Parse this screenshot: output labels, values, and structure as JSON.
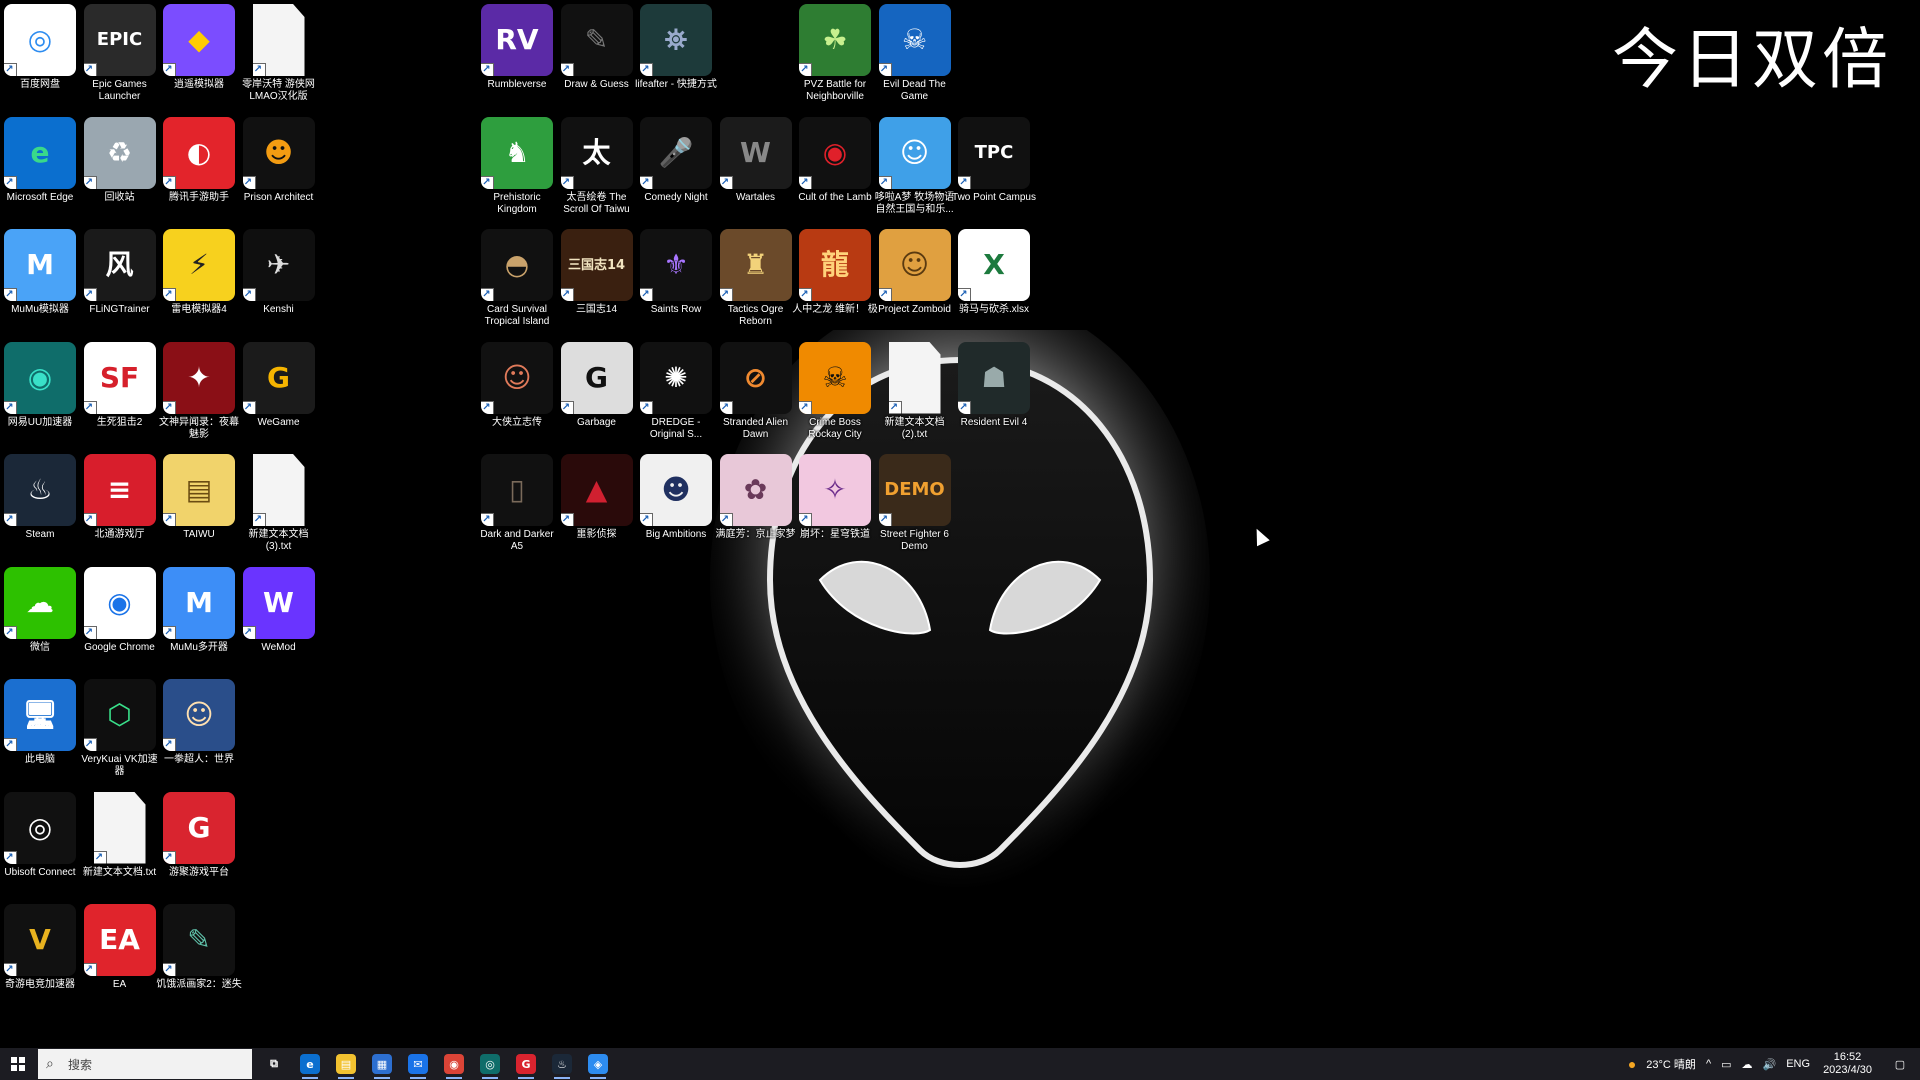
{
  "overlay_text": "今日双倍",
  "desktop_icons": [
    {
      "label": "百度网盘",
      "col": 0,
      "row": 0,
      "bg": "#ffffff",
      "fg": "#2d8cf0",
      "glyph": "◎"
    },
    {
      "label": "Epic Games Launcher",
      "col": 1,
      "row": 0,
      "bg": "#2a2a2a",
      "fg": "#ffffff",
      "glyph": "EPIC"
    },
    {
      "label": "逍遥模拟器",
      "col": 2,
      "row": 0,
      "bg": "#7b4dff",
      "fg": "#ffcc00",
      "glyph": "◆"
    },
    {
      "label": "零岸沃特 游侠网 LMAO汉化版",
      "col": 3,
      "row": 0,
      "bg": "#f4f4f4",
      "fg": "#999999",
      "glyph": ""
    },
    {
      "label": "Microsoft Edge",
      "col": 0,
      "row": 1,
      "bg": "#0b6fcf",
      "fg": "#39d98a",
      "glyph": "e"
    },
    {
      "label": "回收站",
      "col": 1,
      "row": 1,
      "bg": "#9aa7b0",
      "fg": "#ffffff",
      "glyph": "♻"
    },
    {
      "label": "腾讯手游助手",
      "col": 2,
      "row": 1,
      "bg": "#e3242b",
      "fg": "#ffffff",
      "glyph": "◐"
    },
    {
      "label": "Prison Architect",
      "col": 3,
      "row": 1,
      "bg": "#111111",
      "fg": "#f39c12",
      "glyph": "☻"
    },
    {
      "label": "MuMu模拟器",
      "col": 0,
      "row": 2,
      "bg": "#4aa3f7",
      "fg": "#ffffff",
      "glyph": "M"
    },
    {
      "label": "FLiNGTrainer",
      "col": 1,
      "row": 2,
      "bg": "#1a1a1a",
      "fg": "#ffffff",
      "glyph": "风"
    },
    {
      "label": "雷电模拟器4",
      "col": 2,
      "row": 2,
      "bg": "#f7d11e",
      "fg": "#222222",
      "glyph": "⚡"
    },
    {
      "label": "Kenshi",
      "col": 3,
      "row": 2,
      "bg": "#0f0f0f",
      "fg": "#dddddd",
      "glyph": "✈"
    },
    {
      "label": "网易UU加速器",
      "col": 0,
      "row": 3,
      "bg": "#0f6d6a",
      "fg": "#39e0c8",
      "glyph": "◉"
    },
    {
      "label": "生死狙击2",
      "col": 1,
      "row": 3,
      "bg": "#ffffff",
      "fg": "#d6202b",
      "glyph": "SF"
    },
    {
      "label": "文神异闻录：夜幕魅影",
      "col": 2,
      "row": 3,
      "bg": "#8a0f16",
      "fg": "#ffffff",
      "glyph": "✦"
    },
    {
      "label": "WeGame",
      "col": 3,
      "row": 3,
      "bg": "#1b1b1b",
      "fg": "#f5b400",
      "glyph": "G"
    },
    {
      "label": "Steam",
      "col": 0,
      "row": 4,
      "bg": "#1b2838",
      "fg": "#ffffff",
      "glyph": "♨"
    },
    {
      "label": "北通游戏厅",
      "col": 1,
      "row": 4,
      "bg": "#d81e2c",
      "fg": "#ffffff",
      "glyph": "≡"
    },
    {
      "label": "TAIWU",
      "col": 2,
      "row": 4,
      "bg": "#f1d36b",
      "fg": "#6b4c12",
      "glyph": "▤"
    },
    {
      "label": "新建文本文档 (3).txt",
      "col": 3,
      "row": 4,
      "bg": "#f4f4f4",
      "fg": "#999999",
      "glyph": ""
    },
    {
      "label": "微信",
      "col": 0,
      "row": 5,
      "bg": "#2dc100",
      "fg": "#ffffff",
      "glyph": "☁"
    },
    {
      "label": "Google Chrome",
      "col": 1,
      "row": 5,
      "bg": "#ffffff",
      "fg": "#1a73e8",
      "glyph": "◉"
    },
    {
      "label": "MuMu多开器",
      "col": 2,
      "row": 5,
      "bg": "#3d8ef7",
      "fg": "#ffffff",
      "glyph": "M"
    },
    {
      "label": "WeMod",
      "col": 3,
      "row": 5,
      "bg": "#6a34ff",
      "fg": "#ffffff",
      "glyph": "W"
    },
    {
      "label": "此电脑",
      "col": 0,
      "row": 6,
      "bg": "#1b6fd0",
      "fg": "#ffffff",
      "glyph": "🖥"
    },
    {
      "label": "VeryKuai VK加速器",
      "col": 1,
      "row": 6,
      "bg": "#0f0f0f",
      "fg": "#39e08a",
      "glyph": "⬡"
    },
    {
      "label": "一拳超人：世界",
      "col": 2,
      "row": 6,
      "bg": "#2a4e8a",
      "fg": "#ffe0b0",
      "glyph": "☺"
    },
    {
      "label": "Ubisoft Connect",
      "col": 0,
      "row": 7,
      "bg": "#111111",
      "fg": "#ffffff",
      "glyph": "◎"
    },
    {
      "label": "新建文本文档.txt",
      "col": 1,
      "row": 7,
      "bg": "#f4f4f4",
      "fg": "#999999",
      "glyph": ""
    },
    {
      "label": "游聚游戏平台",
      "col": 2,
      "row": 7,
      "bg": "#d9242f",
      "fg": "#ffffff",
      "glyph": "G"
    },
    {
      "label": "奇游电竞加速器",
      "col": 0,
      "row": 8,
      "bg": "#111111",
      "fg": "#e8b21f",
      "glyph": "V"
    },
    {
      "label": "EA",
      "col": 1,
      "row": 8,
      "bg": "#e0242c",
      "fg": "#ffffff",
      "glyph": "EA"
    },
    {
      "label": "饥饿派画家2：迷失",
      "col": 2,
      "row": 8,
      "bg": "#111111",
      "fg": "#5fbfa8",
      "glyph": "✎"
    },
    {
      "label": "Rumbleverse",
      "col": 6,
      "row": 0,
      "bg": "#5b2aa6",
      "fg": "#ffffff",
      "glyph": "RV"
    },
    {
      "label": "Draw & Guess",
      "col": 7,
      "row": 0,
      "bg": "#111111",
      "fg": "#777777",
      "glyph": "✎"
    },
    {
      "label": "lifeafter - 快捷方式",
      "col": 8,
      "row": 0,
      "bg": "#1d3a3a",
      "fg": "#9ac",
      "glyph": "⛯"
    },
    {
      "label": "PVZ Battle for Neighborville",
      "col": 10,
      "row": 0,
      "bg": "#2e7d32",
      "fg": "#c8f08f",
      "glyph": "☘"
    },
    {
      "label": "Evil Dead The Game",
      "col": 11,
      "row": 0,
      "bg": "#1565c0",
      "fg": "#ffffff",
      "glyph": "☠"
    },
    {
      "label": "Prehistoric Kingdom",
      "col": 6,
      "row": 1,
      "bg": "#2e9e3e",
      "fg": "#ffffff",
      "glyph": "♞"
    },
    {
      "label": "太吾绘卷 The Scroll Of Taiwu",
      "col": 7,
      "row": 1,
      "bg": "#111111",
      "fg": "#ffffff",
      "glyph": "太"
    },
    {
      "label": "Comedy Night",
      "col": 8,
      "row": 1,
      "bg": "#111111",
      "fg": "#bbbbbb",
      "glyph": "🎤"
    },
    {
      "label": "Wartales",
      "col": 9,
      "row": 1,
      "bg": "#1b1b1b",
      "fg": "#888888",
      "glyph": "W"
    },
    {
      "label": "Cult of the Lamb",
      "col": 10,
      "row": 1,
      "bg": "#111111",
      "fg": "#e0202a",
      "glyph": "◉"
    },
    {
      "label": "哆啦A梦 牧场物语 自然王国与和乐...",
      "col": 11,
      "row": 1,
      "bg": "#3fa0e8",
      "fg": "#ffffff",
      "glyph": "☺"
    },
    {
      "label": "Two Point Campus",
      "col": 12,
      "row": 1,
      "bg": "#111111",
      "fg": "#ffffff",
      "glyph": "TPC"
    },
    {
      "label": "Card Survival Tropical Island",
      "col": 6,
      "row": 2,
      "bg": "#111111",
      "fg": "#c9a26b",
      "glyph": "◓"
    },
    {
      "label": "三国志14",
      "col": 7,
      "row": 2,
      "bg": "#3a2010",
      "fg": "#f2e4c0",
      "glyph": "三国志14"
    },
    {
      "label": "Saints Row",
      "col": 8,
      "row": 2,
      "bg": "#111111",
      "fg": "#a875ff",
      "glyph": "⚜"
    },
    {
      "label": "Tactics Ogre Reborn",
      "col": 9,
      "row": 2,
      "bg": "#6b4a2a",
      "fg": "#f2d27a",
      "glyph": "♜"
    },
    {
      "label": "人中之龙 维新！ 极",
      "col": 10,
      "row": 2,
      "bg": "#b83a12",
      "fg": "#ffd27a",
      "glyph": "龍"
    },
    {
      "label": "Project Zomboid",
      "col": 11,
      "row": 2,
      "bg": "#e0a040",
      "fg": "#5a3a10",
      "glyph": "☺"
    },
    {
      "label": "骑马与砍杀.xlsx",
      "col": 12,
      "row": 2,
      "bg": "#ffffff",
      "fg": "#1d7a3e",
      "glyph": "X"
    },
    {
      "label": "大侠立志传",
      "col": 6,
      "row": 3,
      "bg": "#111111",
      "fg": "#e07a5a",
      "glyph": "☺"
    },
    {
      "label": "Garbage",
      "col": 7,
      "row": 3,
      "bg": "#dddddd",
      "fg": "#111111",
      "glyph": "G"
    },
    {
      "label": "DREDGE - Original S...",
      "col": 8,
      "row": 3,
      "bg": "#111111",
      "fg": "#ffffff",
      "glyph": "✺"
    },
    {
      "label": "Stranded Alien Dawn",
      "col": 9,
      "row": 3,
      "bg": "#111111",
      "fg": "#f08a30",
      "glyph": "⊘"
    },
    {
      "label": "Crime Boss Rockay City",
      "col": 10,
      "row": 3,
      "bg": "#f08a00",
      "fg": "#111111",
      "glyph": "☠"
    },
    {
      "label": "新建文本文档 (2).txt",
      "col": 11,
      "row": 3,
      "bg": "#f4f4f4",
      "fg": "#999999",
      "glyph": ""
    },
    {
      "label": "Resident Evil 4",
      "col": 12,
      "row": 3,
      "bg": "#202a2a",
      "fg": "#9aa",
      "glyph": "☗"
    },
    {
      "label": "Dark and Darker A5",
      "col": 6,
      "row": 4,
      "bg": "#111111",
      "fg": "#7a6a5a",
      "glyph": "▯"
    },
    {
      "label": "噩影侦探",
      "col": 7,
      "row": 4,
      "bg": "#2a0a0a",
      "fg": "#d02030",
      "glyph": "▲"
    },
    {
      "label": "Big Ambitions",
      "col": 8,
      "row": 4,
      "bg": "#f0f0f0",
      "fg": "#203060",
      "glyph": "☻"
    },
    {
      "label": "满庭芳：京止家梦",
      "col": 9,
      "row": 4,
      "bg": "#e8c8d8",
      "fg": "#6a3a5a",
      "glyph": "✿"
    },
    {
      "label": "崩坏：星穹铁道",
      "col": 10,
      "row": 4,
      "bg": "#f2c8e0",
      "fg": "#6a2a8a",
      "glyph": "✧"
    },
    {
      "label": "Street Fighter 6 Demo",
      "col": 11,
      "row": 4,
      "bg": "#3a2a1a",
      "fg": "#f0a030",
      "glyph": "DEMO"
    }
  ],
  "taskbar": {
    "search_placeholder": "搜索",
    "apps": [
      {
        "name": "task-view",
        "glyph": "⧉",
        "bg": "transparent"
      },
      {
        "name": "edge",
        "glyph": "e",
        "bg": "#0b6fcf"
      },
      {
        "name": "file-explorer",
        "glyph": "▤",
        "bg": "#f2c230"
      },
      {
        "name": "store",
        "glyph": "▦",
        "bg": "#2d6fd0"
      },
      {
        "name": "mail",
        "glyph": "✉",
        "bg": "#1a73e8"
      },
      {
        "name": "chrome",
        "glyph": "◉",
        "bg": "#db4437"
      },
      {
        "name": "uu-booster",
        "glyph": "◎",
        "bg": "#0f6d6a"
      },
      {
        "name": "youju",
        "glyph": "G",
        "bg": "#d9242f"
      },
      {
        "name": "steam",
        "glyph": "♨",
        "bg": "#1b2838"
      },
      {
        "name": "qq-speed",
        "glyph": "◈",
        "bg": "#2d8cf0"
      }
    ],
    "weather": "23°C 晴朗",
    "lang": "ENG",
    "time": "16:52",
    "date": "2023/4/30"
  }
}
